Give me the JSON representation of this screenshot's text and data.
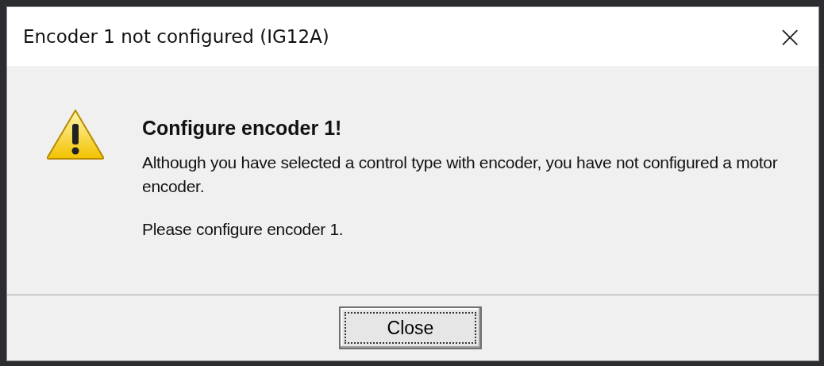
{
  "window": {
    "title": "Encoder 1 not configured (IG12A)",
    "close_glyph": "×"
  },
  "message": {
    "heading": "Configure encoder 1!",
    "paragraphs": [
      "Although you have selected a control type with encoder, you have not configured a motor encoder.",
      "Please configure encoder 1."
    ]
  },
  "buttons": [
    {
      "label": "Close",
      "focused": true
    }
  ]
}
